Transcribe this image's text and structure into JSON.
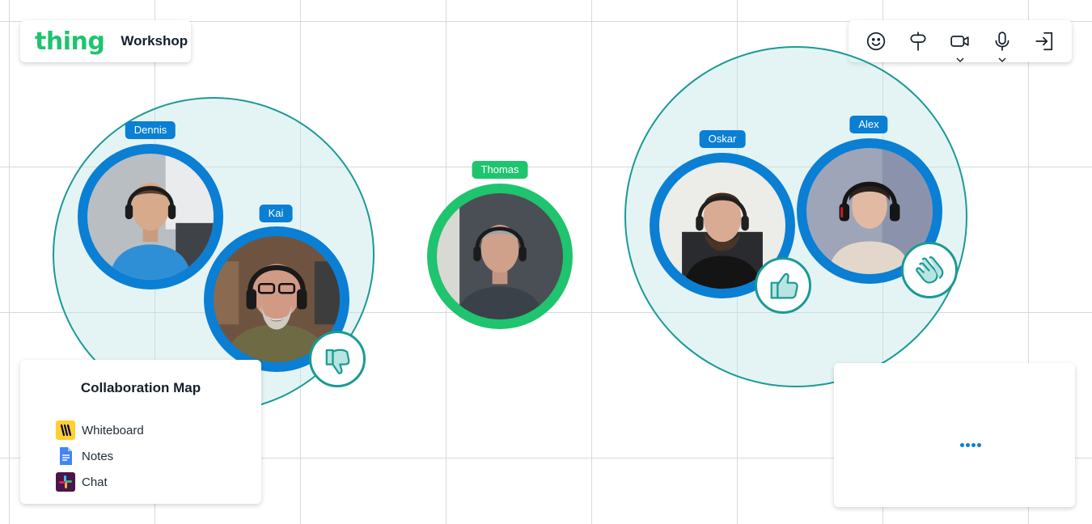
{
  "brand": {
    "logo": "thing",
    "workspace": "Workshop"
  },
  "toolbar": {
    "items": [
      {
        "icon": "smiley-icon",
        "label": "Reactions"
      },
      {
        "icon": "signpost-icon",
        "label": "Sign"
      },
      {
        "icon": "video-camera-icon",
        "label": "Camera"
      },
      {
        "icon": "microphone-icon",
        "label": "Microphone"
      },
      {
        "icon": "exit-icon",
        "label": "Leave"
      }
    ]
  },
  "participants": [
    {
      "name": "Dennis",
      "reaction": null
    },
    {
      "name": "Kai",
      "reaction": "thumbs-down-icon"
    },
    {
      "name": "Thomas",
      "reaction": null
    },
    {
      "name": "Oskar",
      "reaction": "thumbs-up-icon"
    },
    {
      "name": "Alex",
      "reaction": "clapping-hands-icon"
    }
  ],
  "collaboration_map": {
    "title": "Collaboration Map",
    "items": [
      {
        "label": "Whiteboard",
        "icon": "miro-icon"
      },
      {
        "label": "Notes",
        "icon": "google-docs-icon"
      },
      {
        "label": "Chat",
        "icon": "slack-icon"
      }
    ]
  },
  "colors": {
    "brand_green": "#1fc46e",
    "participant_blue": "#0a7fd4",
    "space_teal": "#1a9a94",
    "space_fill": "#e3f3f3"
  }
}
